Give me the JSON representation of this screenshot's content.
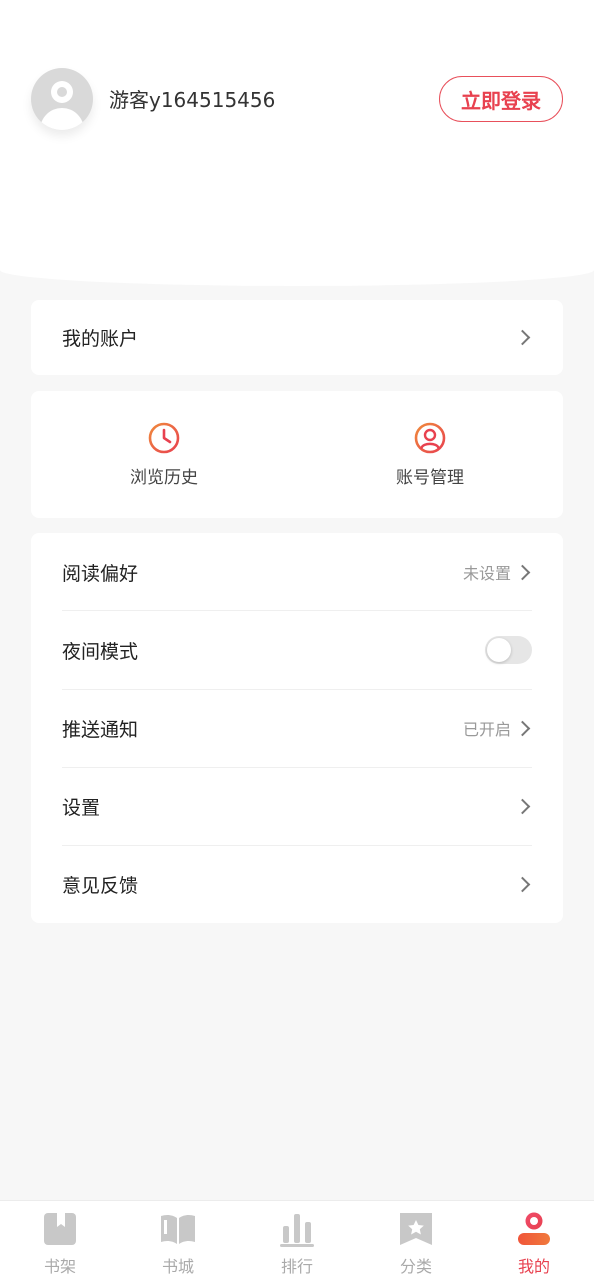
{
  "profile": {
    "username": "游客y164515456",
    "login_label": "立即登录"
  },
  "account": {
    "label": "我的账户"
  },
  "shortcuts": [
    {
      "label": "浏览历史",
      "icon": "clock-icon"
    },
    {
      "label": "账号管理",
      "icon": "user-circle-icon"
    }
  ],
  "settings": {
    "reading_pref": {
      "label": "阅读偏好",
      "value": "未设置"
    },
    "night_mode": {
      "label": "夜间模式",
      "enabled": false
    },
    "push": {
      "label": "推送通知",
      "value": "已开启"
    },
    "settings": {
      "label": "设置"
    },
    "feedback": {
      "label": "意见反馈"
    }
  },
  "tabs": [
    {
      "label": "书架",
      "icon": "bookshelf-icon",
      "active": false
    },
    {
      "label": "书城",
      "icon": "open-book-icon",
      "active": false
    },
    {
      "label": "排行",
      "icon": "ranking-bars-icon",
      "active": false
    },
    {
      "label": "分类",
      "icon": "category-star-icon",
      "active": false
    },
    {
      "label": "我的",
      "icon": "me-user-icon",
      "active": true
    }
  ],
  "colors": {
    "accent": "#e8414f",
    "accent_gradient_end": "#f08a3c",
    "background": "#f7f7f7",
    "inactive_icon": "#c8c8c8"
  }
}
